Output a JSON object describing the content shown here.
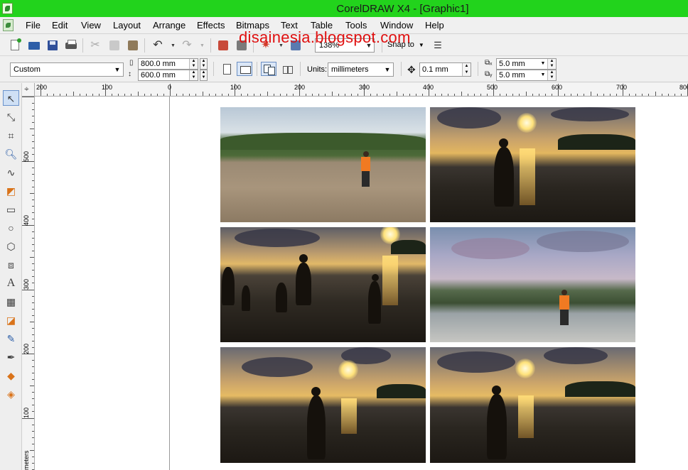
{
  "window": {
    "title": "CorelDRAW X4 - [Graphic1]"
  },
  "watermark": "disainesia.blogspot.com",
  "menu": [
    "File",
    "Edit",
    "View",
    "Layout",
    "Arrange",
    "Effects",
    "Bitmaps",
    "Text",
    "Table",
    "Tools",
    "Window",
    "Help"
  ],
  "toolbar": {
    "zoom": "138%",
    "snap_to": "Snap to",
    "icons": [
      "new-icon",
      "open-icon",
      "save-icon",
      "print-icon",
      "cut-icon",
      "copy-icon",
      "paste-icon",
      "undo-icon",
      "redo-icon",
      "import-icon",
      "export-icon",
      "application-launcher-icon",
      "welcome-screen-icon",
      "options-icon"
    ]
  },
  "property_bar": {
    "paper_type": "Custom",
    "page_width": "800.0 mm",
    "page_height": "600.0 mm",
    "units_label": "Units:",
    "units": "millimeters",
    "nudge": "0.1 mm",
    "duplicate_x": "5.0 mm",
    "duplicate_y": "5.0 mm"
  },
  "rulers": {
    "horizontal": [
      "200",
      "100",
      "0",
      "100",
      "200",
      "300",
      "400",
      "500",
      "600",
      "700",
      "800"
    ],
    "vertical": [
      "500",
      "400",
      "300",
      "200",
      "100"
    ],
    "unit_label": "meters"
  },
  "toolbox": [
    "pick-tool-icon",
    "shape-tool-icon",
    "crop-tool-icon",
    "zoom-tool-icon",
    "freehand-tool-icon",
    "smart-fill-tool-icon",
    "rectangle-tool-icon",
    "ellipse-tool-icon",
    "polygon-tool-icon",
    "basic-shapes-tool-icon",
    "text-tool-icon",
    "table-tool-icon",
    "interactive-effects-tool-icon",
    "eyedropper-tool-icon",
    "outline-tool-icon",
    "fill-tool-icon",
    "interactive-fill-tool-icon"
  ],
  "colors": {
    "titlebar": "#22d31c",
    "watermark": "#e01010",
    "canvas": "#ffffff"
  }
}
